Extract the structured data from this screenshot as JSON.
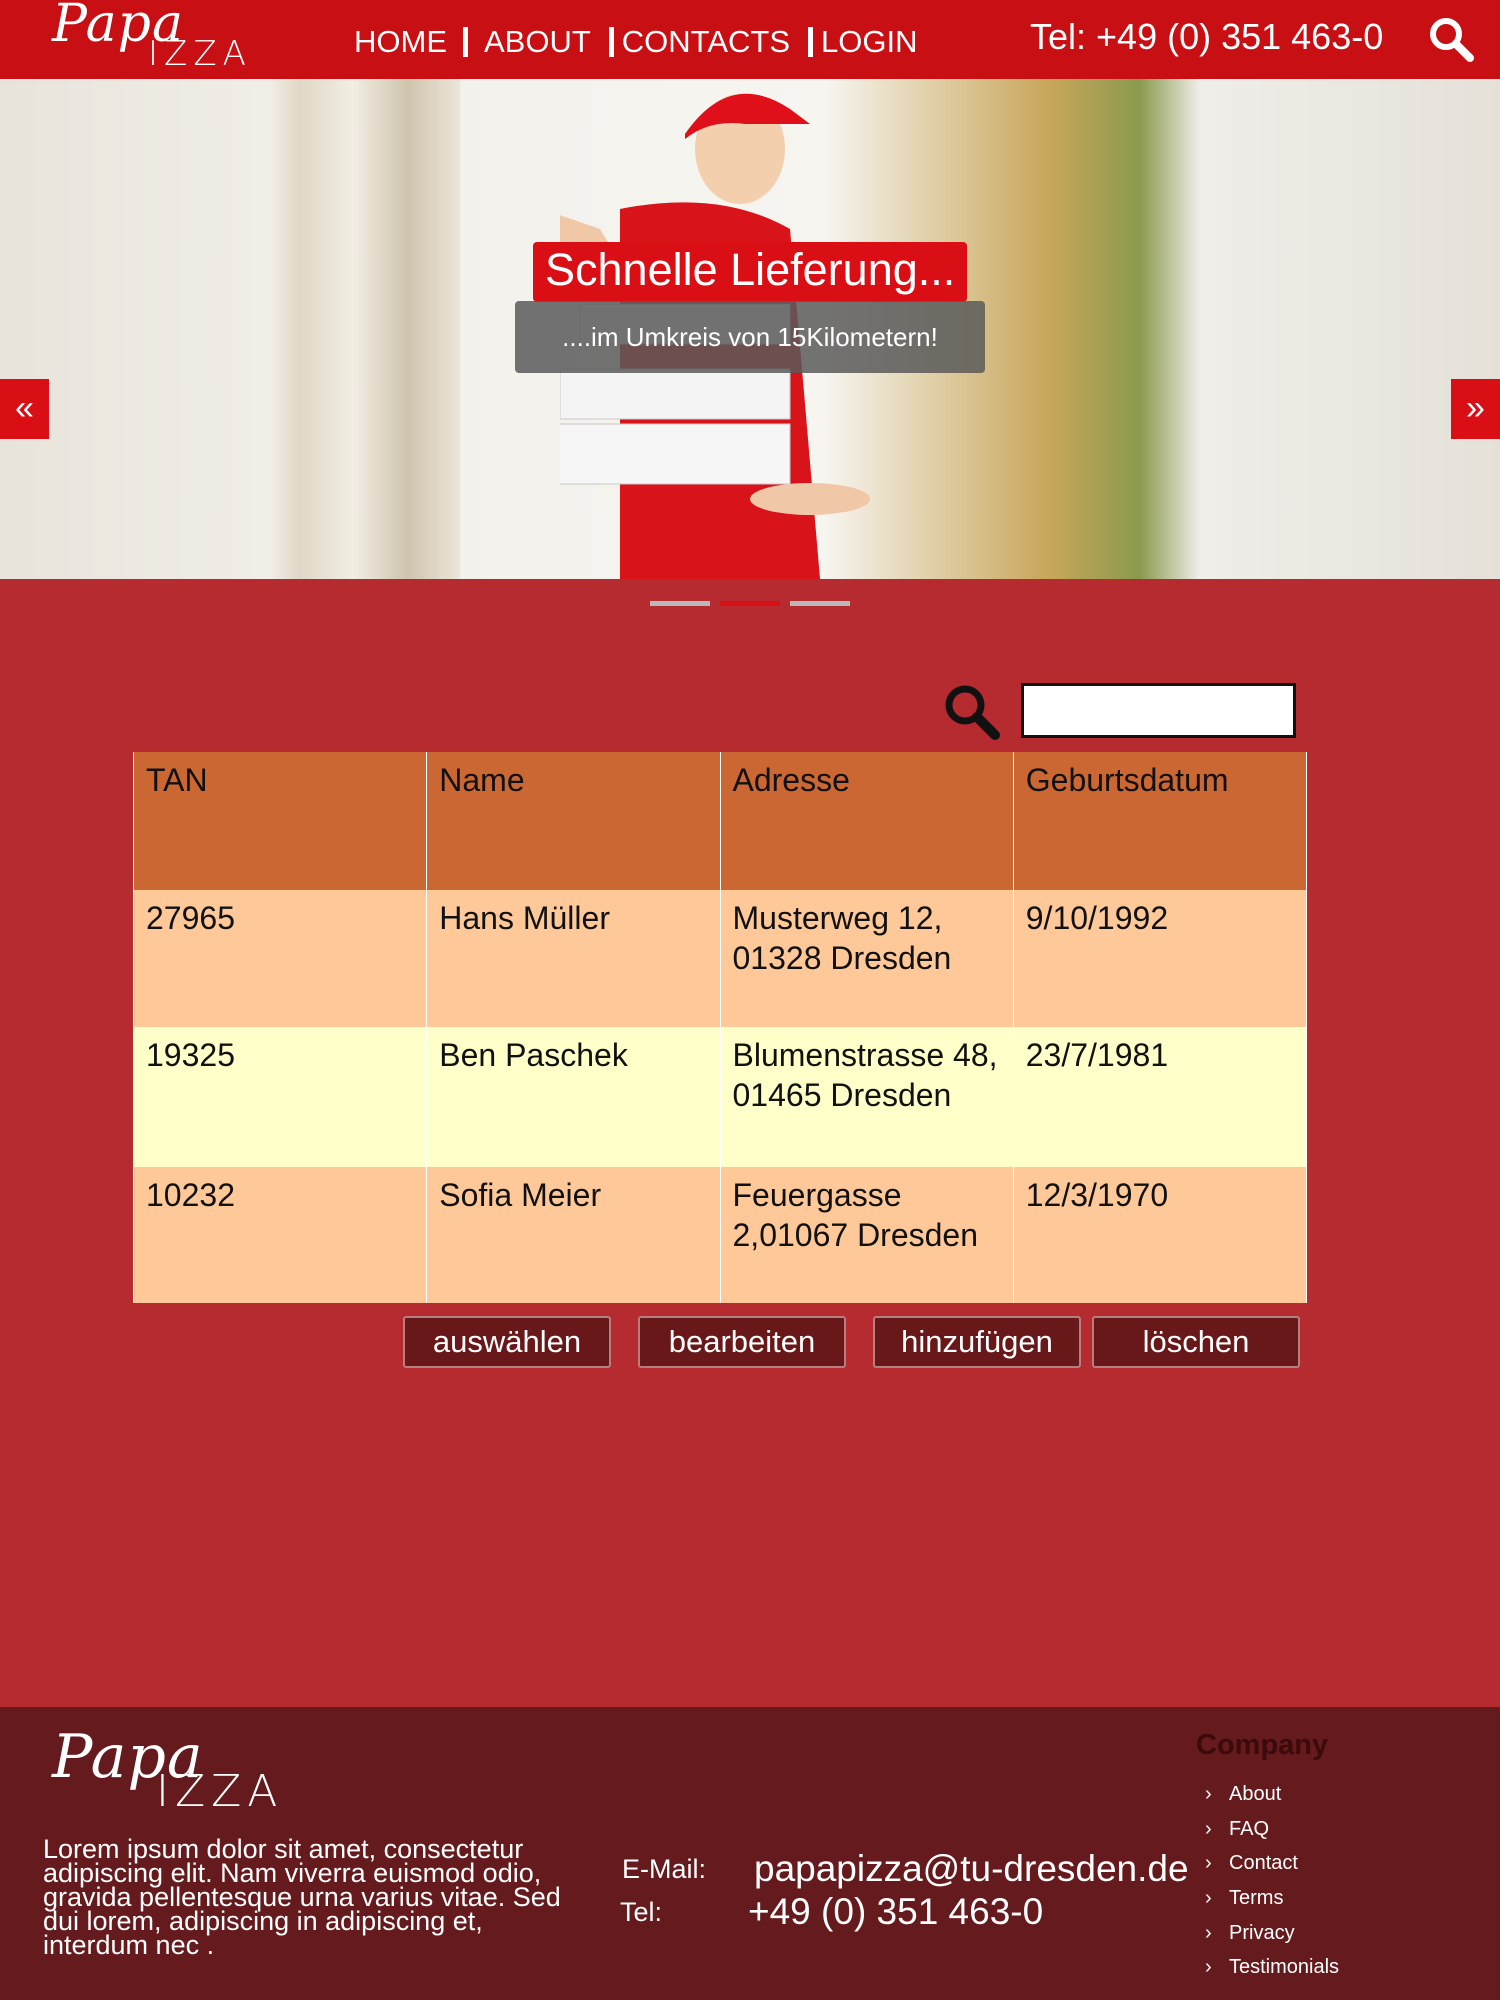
{
  "header": {
    "logo_line1": "Papa",
    "logo_line2": "IZZA",
    "nav": [
      "HOME",
      "ABOUT",
      "CONTACTS",
      "LOGIN"
    ],
    "phone": "Tel: +49 (0) 351 463-0"
  },
  "hero": {
    "title": "Schnelle Lieferung...",
    "subtitle": "....im Umkreis von  15Kilometern!",
    "prev_icon": "«",
    "next_icon": "»",
    "slides": 3,
    "active_slide": 2
  },
  "search": {
    "value": "",
    "placeholder": ""
  },
  "table": {
    "headers": [
      "TAN",
      "Name",
      "Adresse",
      "Geburtsdatum"
    ],
    "rows": [
      [
        "27965",
        "Hans Müller",
        "Musterweg 12, 01328 Dresden",
        "9/10/1992"
      ],
      [
        "19325",
        "Ben Paschek",
        "Blumenstrasse 48, 01465 Dresden",
        "23/7/1981"
      ],
      [
        "10232",
        "Sofia Meier",
        "Feuergasse 2,01067 Dresden",
        "12/3/1970"
      ]
    ]
  },
  "actions": {
    "select": "auswählen",
    "edit": "bearbeiten",
    "add": "hinzufügen",
    "delete": "löschen"
  },
  "footer": {
    "logo_line1": "Papa",
    "logo_line2": "IZZA",
    "lorem": "Lorem ipsum dolor sit amet, consectetur adipiscing elit. Nam viverra euismod odio, gravida pellentesque urna varius vitae. Sed dui lorem, adipiscing in adipiscing et, interdum nec .",
    "email_label": "E-Mail:",
    "email": "papapizza@tu-dresden.de",
    "tel_label": "Tel:",
    "tel": "+49 (0) 351 463-0",
    "company_title": "Company",
    "company_links": [
      "About",
      "FAQ",
      "Contact",
      "Terms",
      "Privacy",
      "Testimonials"
    ]
  },
  "colors": {
    "header_red": "#c80f14",
    "page_bg": "#b62b2f",
    "footer_bg": "#651a1d",
    "table_header": "#cb6733",
    "row_odd": "#fec899",
    "row_even": "#ffffc9",
    "button_bg": "#681819"
  }
}
